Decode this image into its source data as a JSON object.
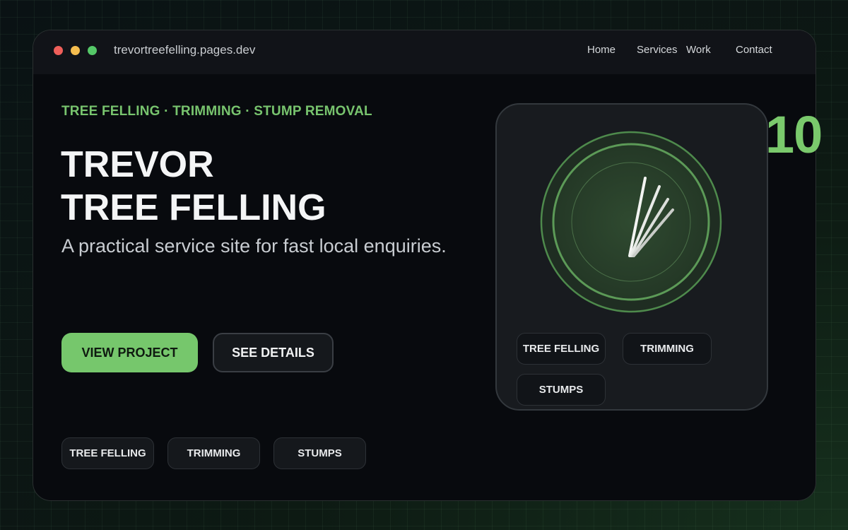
{
  "browser": {
    "url": "trevortreefelling.pages.dev",
    "nav": [
      "Home",
      "Services",
      "Work",
      "Contact"
    ]
  },
  "hero": {
    "eyebrow": "TREE FELLING · TRIMMING · STUMP REMOVAL",
    "title_line1": "TREVOR",
    "title_line2": "TREE FELLING",
    "subtitle": "A practical service site for fast local enquiries.",
    "primary_button": "VIEW PROJECT",
    "secondary_button": "SEE DETAILS",
    "chips": [
      "TREE FELLING",
      "TRIMMING",
      "STUMPS"
    ]
  },
  "card": {
    "chips": [
      "TREE FELLING",
      "TRIMMING",
      "STUMPS"
    ]
  },
  "counter": "10",
  "colors": {
    "accent": "#76c76c",
    "background": "#080a0e",
    "card": "#181b1f"
  }
}
